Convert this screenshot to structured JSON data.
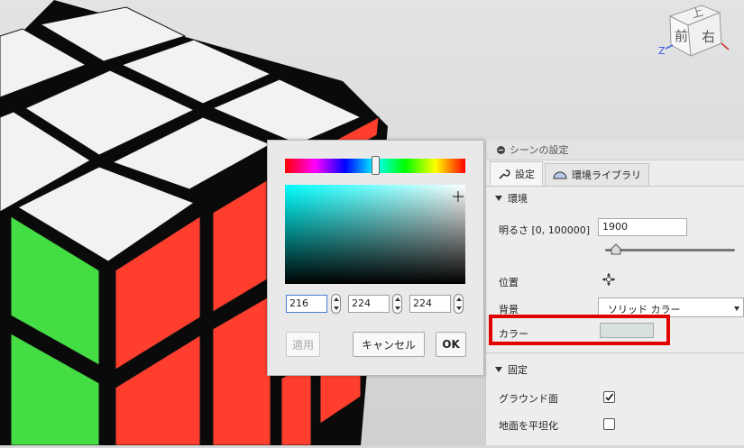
{
  "colors": {
    "sticker_white": "#f2f2f2",
    "sticker_green": "#44dd44",
    "sticker_red": "#ff3e2e",
    "highlight": "#e00000",
    "swatch": "#d8e0e0"
  },
  "viewcube": {
    "face_top": "上",
    "face_front": "前",
    "face_right": "右",
    "axis_z": "Z"
  },
  "panel": {
    "title": "シーンの設定",
    "tabs": [
      {
        "label": "設定",
        "icon": "wrench-icon"
      },
      {
        "label": "環境ライブラリ",
        "icon": "dome-icon"
      }
    ],
    "environment": {
      "section": "環境",
      "brightness_label": "明るさ [0, 100000]",
      "brightness_value": "1900",
      "brightness_slider_fraction": 0.08,
      "position_label": "位置",
      "background_label": "背景",
      "background_value": "ソリッド カラー",
      "color_label": "カラー"
    },
    "fixed": {
      "section": "固定",
      "ground_plane_label": "グラウンド面",
      "ground_plane_checked": true,
      "flatten_ground_label": "地面を平坦化",
      "flatten_ground_checked": false
    }
  },
  "dialog": {
    "hue_fraction": 0.5,
    "r": "216",
    "g": "224",
    "b": "224",
    "apply_label": "適用",
    "cancel_label": "キャンセル",
    "ok_label": "OK"
  }
}
